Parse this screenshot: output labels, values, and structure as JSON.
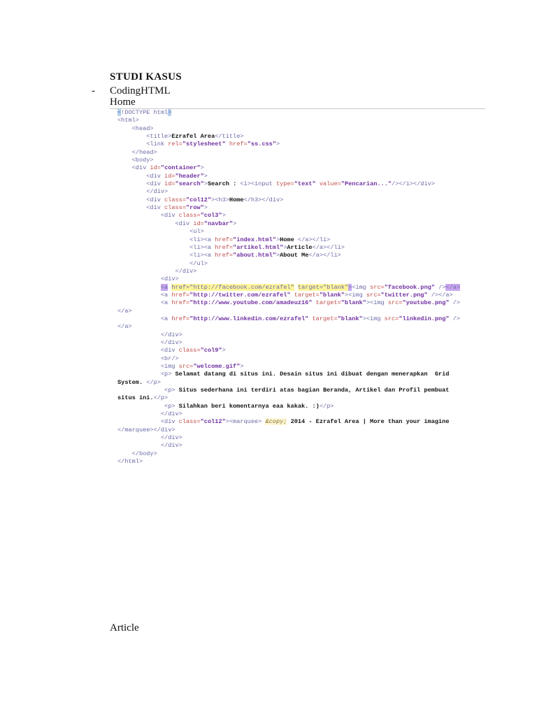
{
  "heading": "STUDI KASUS",
  "bullet": "-",
  "item": "CodingHTML",
  "section_home": "Home",
  "section_article": "Article",
  "code_lines": [
    [
      [
        "hb",
        "<"
      ],
      [
        "t",
        "!DOCTYPE html"
      ],
      [
        "hb",
        ">"
      ]
    ],
    [
      [
        "t",
        "<html>"
      ]
    ],
    [
      [
        "t",
        "    <head>"
      ]
    ],
    [
      [
        "t",
        "        <title>"
      ],
      [
        "x",
        "Ezrafel Area"
      ],
      [
        "t",
        "</title>"
      ]
    ],
    [
      [
        "t",
        "        <link "
      ],
      [
        "a",
        "rel="
      ],
      [
        "v",
        "\"stylesheet\""
      ],
      [
        "a",
        " href="
      ],
      [
        "v",
        "\"ss.css\""
      ],
      [
        "t",
        ">"
      ]
    ],
    [
      [
        "t",
        "    </head>"
      ]
    ],
    [
      [
        "t",
        "    <body>"
      ]
    ],
    [
      [
        "t",
        "    <div "
      ],
      [
        "a",
        "id="
      ],
      [
        "v",
        "\"container\""
      ],
      [
        "t",
        ">"
      ]
    ],
    [
      [
        "t",
        "        <div "
      ],
      [
        "a",
        "id="
      ],
      [
        "v",
        "\"header\""
      ],
      [
        "t",
        ">"
      ]
    ],
    [
      [
        "t",
        "        <div "
      ],
      [
        "a",
        "id="
      ],
      [
        "v",
        "\"search\""
      ],
      [
        "t",
        ">"
      ],
      [
        "x",
        "Search : "
      ],
      [
        "t",
        "<i><input "
      ],
      [
        "a",
        "type="
      ],
      [
        "v",
        "\"text\""
      ],
      [
        "a",
        " value="
      ],
      [
        "v",
        "\"Pencarian...\""
      ],
      [
        "t",
        "/></i></div>"
      ]
    ],
    [
      [
        "t",
        "        </div>"
      ]
    ],
    [
      [
        "t",
        "        <div "
      ],
      [
        "a",
        "class="
      ],
      [
        "v",
        "\"col12\""
      ],
      [
        "t",
        "><h3>"
      ],
      [
        "x",
        "Home"
      ],
      [
        "t",
        "</h3></div>"
      ]
    ],
    [
      [
        "t",
        "        <div "
      ],
      [
        "a",
        "class="
      ],
      [
        "v",
        "\"row\""
      ],
      [
        "t",
        ">"
      ]
    ],
    [
      [
        "t",
        "            <div "
      ],
      [
        "a",
        "class="
      ],
      [
        "v",
        "\"col3\""
      ],
      [
        "t",
        ">"
      ]
    ],
    [
      [
        "t",
        "                <div "
      ],
      [
        "a",
        "id="
      ],
      [
        "v",
        "\"navbar\""
      ],
      [
        "t",
        ">"
      ]
    ],
    [
      [
        "t",
        "                    <ul>"
      ]
    ],
    [
      [
        "t",
        "                    <li><a "
      ],
      [
        "a",
        "href="
      ],
      [
        "v",
        "\"index.html\""
      ],
      [
        "t",
        ">"
      ],
      [
        "x",
        "Home "
      ],
      [
        "t",
        "</a></li>"
      ]
    ],
    [
      [
        "t",
        "                    <li><a "
      ],
      [
        "a",
        "href="
      ],
      [
        "v",
        "\"artikel.html\""
      ],
      [
        "t",
        ">"
      ],
      [
        "x",
        "Article"
      ],
      [
        "t",
        "</a></li>"
      ]
    ],
    [
      [
        "t",
        "                    <li><a "
      ],
      [
        "a",
        "href="
      ],
      [
        "v",
        "\"about.html\""
      ],
      [
        "t",
        ">"
      ],
      [
        "x",
        "About Me"
      ],
      [
        "t",
        "</a></li>"
      ]
    ],
    [
      [
        "t",
        "                    </ul>"
      ]
    ],
    [
      [
        "t",
        "                </div>"
      ]
    ],
    [
      [
        "t",
        "            <div>"
      ]
    ],
    [
      [
        "t",
        "            "
      ],
      [
        "hp",
        "<a"
      ],
      [
        "t",
        " "
      ],
      [
        "hy",
        "href=\"http://facebook.com/ezrafel\""
      ],
      [
        "t",
        " "
      ],
      [
        "hy",
        "target=\"blank\""
      ],
      [
        "hp",
        ">"
      ],
      [
        "t",
        "<img "
      ],
      [
        "a",
        "src="
      ],
      [
        "v",
        "\"facebook.png\""
      ],
      [
        "t",
        " />"
      ],
      [
        "hp",
        "</a>"
      ]
    ],
    [
      [
        "t",
        "            <a "
      ],
      [
        "a",
        "href="
      ],
      [
        "v",
        "\"http://twitter.com/ezrafel\""
      ],
      [
        "a",
        " target="
      ],
      [
        "v",
        "\"blank\""
      ],
      [
        "t",
        "><img "
      ],
      [
        "a",
        "src="
      ],
      [
        "v",
        "\"twitter.png\""
      ],
      [
        "t",
        " /></a>"
      ]
    ],
    [
      [
        "t",
        "            <a "
      ],
      [
        "a",
        "href="
      ],
      [
        "v",
        "\"http://www.youtube.com/amadeuz16\""
      ],
      [
        "a",
        " target="
      ],
      [
        "v",
        "\"blank\""
      ],
      [
        "t",
        "><img "
      ],
      [
        "a",
        "src="
      ],
      [
        "v",
        "\"youtube.png\""
      ],
      [
        "t",
        " />"
      ]
    ],
    [
      [
        "t",
        "</a>"
      ]
    ],
    [
      [
        "t",
        "            <a "
      ],
      [
        "a",
        "href="
      ],
      [
        "v",
        "\"http://www.linkedin.com/ezrafel\""
      ],
      [
        "a",
        " target="
      ],
      [
        "v",
        "\"blank\""
      ],
      [
        "t",
        "><img "
      ],
      [
        "a",
        "src="
      ],
      [
        "v",
        "\"linkedin.png\""
      ],
      [
        "t",
        " />"
      ]
    ],
    [
      [
        "t",
        "</a>"
      ]
    ],
    [
      [
        "t",
        "            </div>"
      ]
    ],
    [
      [
        "t",
        "            </div>"
      ]
    ],
    [
      [
        "t",
        "            <div "
      ],
      [
        "a",
        "class="
      ],
      [
        "v",
        "\"col9\""
      ],
      [
        "t",
        ">"
      ]
    ],
    [
      [
        "t",
        "            <br/>"
      ]
    ],
    [
      [
        "t",
        "            <img "
      ],
      [
        "a",
        "src="
      ],
      [
        "v",
        "\"welcome.gif\""
      ],
      [
        "t",
        ">"
      ]
    ],
    [
      [
        "t",
        "            <p>"
      ],
      [
        "x",
        " Selamat datang di situs ini. Desain situs ini dibuat dengan menerapkan  Grid"
      ]
    ],
    [
      [
        "x",
        "System. "
      ],
      [
        "t",
        "</p>"
      ]
    ],
    [
      [
        "t",
        "             <p>"
      ],
      [
        "x",
        " Situs sederhana ini terdiri atas bagian Beranda, Artikel dan Profil pembuat"
      ]
    ],
    [
      [
        "x",
        "situs ini."
      ],
      [
        "t",
        "</p>"
      ]
    ],
    [
      [
        "t",
        "             <p>"
      ],
      [
        "x",
        " Silahkan beri komentarnya eaa kakak. :)"
      ],
      [
        "t",
        "</p>"
      ]
    ],
    [
      [
        "t",
        "            </div>"
      ]
    ],
    [
      [
        "t",
        "            <div "
      ],
      [
        "a",
        "class="
      ],
      [
        "v",
        "\"col12\""
      ],
      [
        "t",
        "><marquee> "
      ],
      [
        "i",
        "&copy;"
      ],
      [
        "x",
        " 2014 - Ezrafel Area | More than your imagine"
      ]
    ],
    [
      [
        "t",
        "</marquee></div>"
      ]
    ],
    [
      [
        "t",
        "            </div>"
      ]
    ],
    [
      [
        "t",
        "            </div>"
      ]
    ],
    [
      [
        "t",
        "    </body>"
      ]
    ],
    [
      [
        "t",
        "</html>"
      ]
    ]
  ]
}
